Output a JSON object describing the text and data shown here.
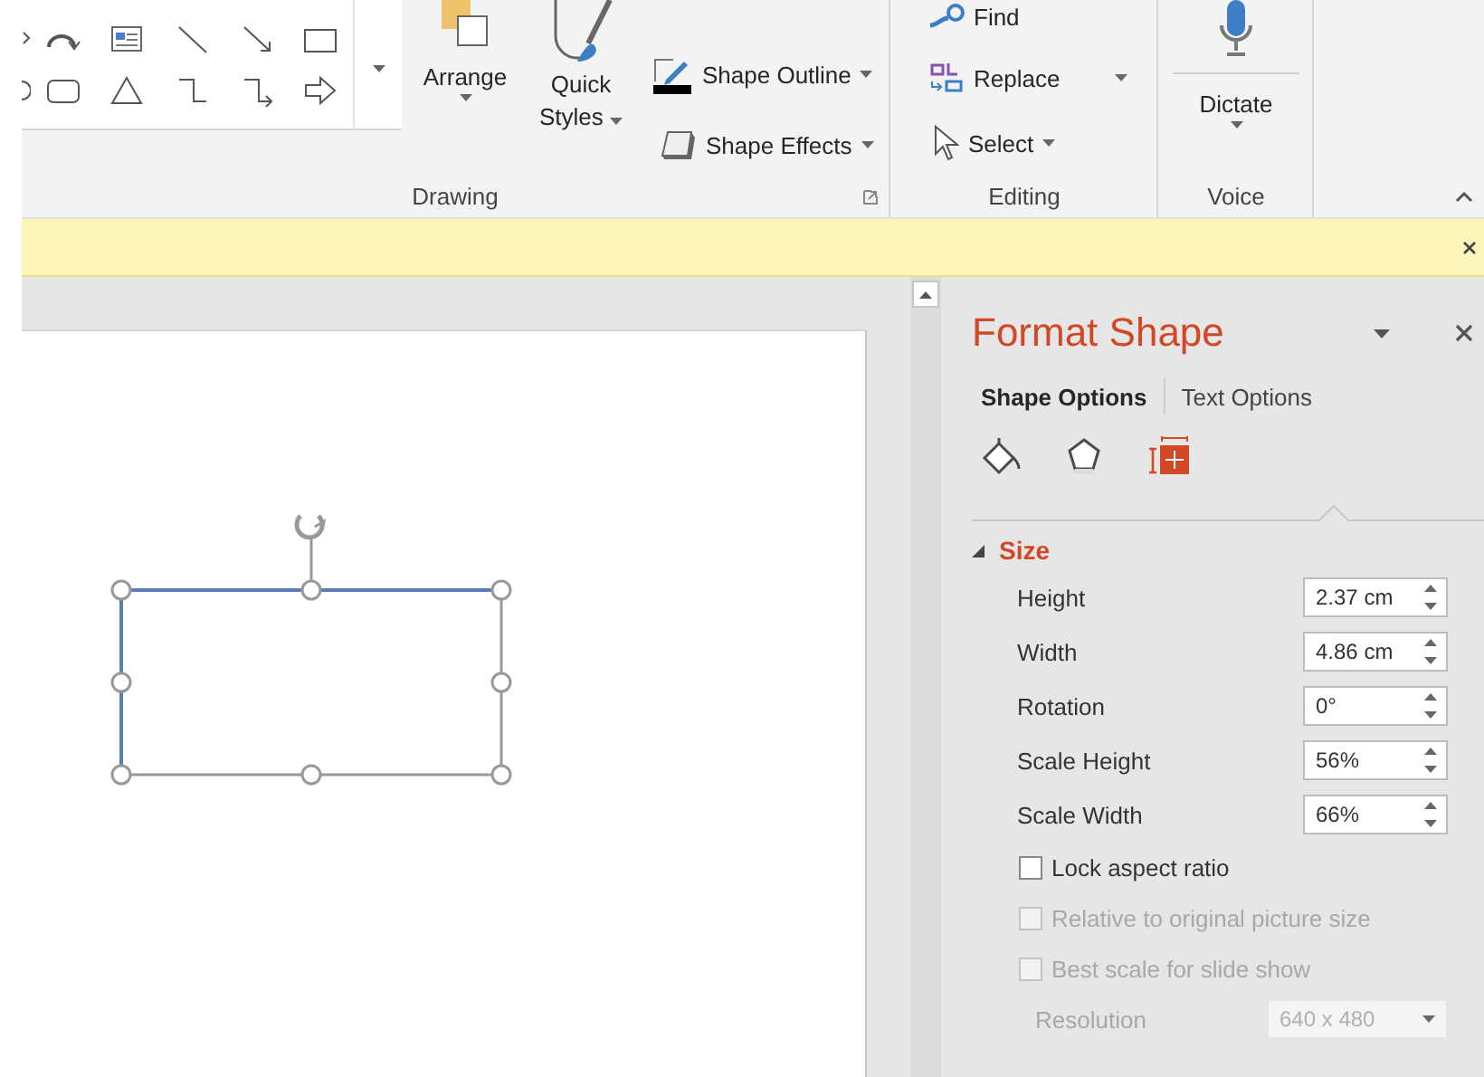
{
  "ribbon": {
    "drawing": {
      "label": "Drawing",
      "arrange": "Arrange",
      "quick_styles": "Quick Styles",
      "shape_outline": "Shape Outline",
      "shape_effects": "Shape Effects"
    },
    "editing": {
      "label": "Editing",
      "find": "Find",
      "replace": "Replace",
      "select": "Select"
    },
    "voice": {
      "label": "Voice",
      "dictate": "Dictate"
    }
  },
  "format_pane": {
    "title": "Format Shape",
    "tabs": [
      {
        "label": "Shape Options",
        "selected": true
      },
      {
        "label": "Text Options",
        "selected": false
      }
    ],
    "icon_tabs": [
      {
        "kind": "fill",
        "selected": false
      },
      {
        "kind": "effects",
        "selected": false
      },
      {
        "kind": "size",
        "selected": true
      }
    ],
    "section": {
      "title": "Size",
      "expanded": true,
      "fields": [
        {
          "label": "Height",
          "value": "2.37 cm"
        },
        {
          "label": "Width",
          "value": "4.86 cm"
        },
        {
          "label": "Rotation",
          "value": "0°"
        },
        {
          "label": "Scale Height",
          "value": "56%"
        },
        {
          "label": "Scale Width",
          "value": "66%"
        }
      ],
      "checkboxes": [
        {
          "label": "Lock aspect ratio",
          "checked": false,
          "disabled": false
        },
        {
          "label": "Relative to original picture size",
          "checked": false,
          "disabled": true
        },
        {
          "label": "Best scale for slide show",
          "checked": false,
          "disabled": true
        }
      ],
      "resolution": {
        "label": "Resolution",
        "value": "640 x 480",
        "disabled": true
      }
    }
  }
}
